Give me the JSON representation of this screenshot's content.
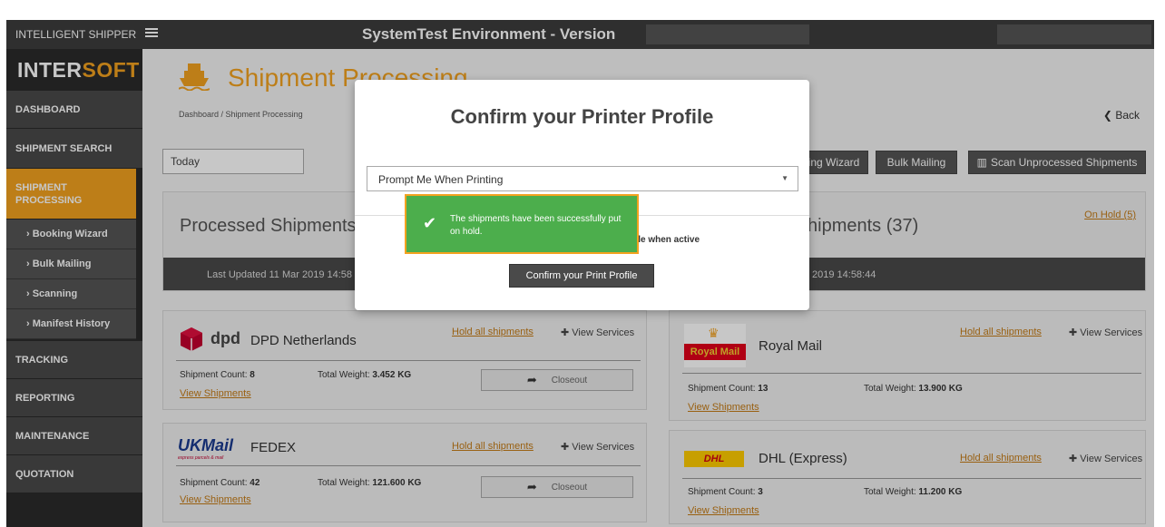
{
  "topbar": {
    "app_name": "INTELLIGENT SHIPPER",
    "environment_title": "SystemTest Environment - Version"
  },
  "sidebar": {
    "logo_a": "INTER",
    "logo_b": "SOFT",
    "items": [
      {
        "label": "DASHBOARD"
      },
      {
        "label": "SHIPMENT SEARCH"
      },
      {
        "label": "SHIPMENT PROCESSING"
      },
      {
        "label": "› Booking Wizard"
      },
      {
        "label": "› Bulk Mailing"
      },
      {
        "label": "› Scanning"
      },
      {
        "label": "› Manifest History"
      },
      {
        "label": "TRACKING"
      },
      {
        "label": "REPORTING"
      },
      {
        "label": "MAINTENANCE"
      },
      {
        "label": "QUOTATION"
      }
    ]
  },
  "main": {
    "page_title": "Shipment Processing",
    "breadcrumb": "Dashboard  /  Shipment Processing",
    "back_label": "Back",
    "date_filter": "Today",
    "buttons": {
      "booking_wizard": "ing Wizard",
      "bulk_mailing": "Bulk Mailing",
      "scan_unprocessed": "Scan Unprocessed Shipments"
    },
    "processed": {
      "title": "Processed Shipments",
      "last_updated": "Last Updated 11 Mar 2019 14:58"
    },
    "unprocessed": {
      "title": "hipments (37)",
      "on_hold": "On Hold (5)",
      "last_updated": "2019 14:58:44"
    },
    "carriers": [
      {
        "name": "DPD Netherlands",
        "logo": "dpd",
        "count_label": "Shipment Count:",
        "count": "8",
        "weight_label": "Total Weight:",
        "weight": "3.452 KG",
        "hold": "Hold all shipments",
        "services": "View Services",
        "view": "View Shipments",
        "closeout": "Closeout"
      },
      {
        "name": "FEDEX",
        "logo": "UKMail",
        "logo_sub": "express parcels & mail",
        "count_label": "Shipment Count:",
        "count": "42",
        "weight_label": "Total Weight:",
        "weight": "121.600 KG",
        "hold": "Hold all shipments",
        "services": "View Services",
        "view": "View Shipments",
        "closeout": "Closeout"
      },
      {
        "name": "Royal Mail",
        "logo": "Royal Mail",
        "count_label": "Shipment Count:",
        "count": "13",
        "weight_label": "Total Weight:",
        "weight": "13.900 KG",
        "hold": "Hold all shipments",
        "services": "View Services",
        "view": "View Shipments"
      },
      {
        "name": "DHL (Express)",
        "logo": "DHL",
        "count_label": "Shipment Count:",
        "count": "3",
        "weight_label": "Total Weight:",
        "weight": "11.200 KG",
        "hold": "Hold all shipments",
        "services": "View Services",
        "view": "View Shipments"
      }
    ]
  },
  "modal": {
    "title": "Confirm your Printer Profile",
    "select_value": "Prompt Me When Printing",
    "note": "ofile when active",
    "confirm_button": "Confirm your Print Profile"
  },
  "toast": {
    "message": "The shipments have been successfully put on hold."
  },
  "colors": {
    "accent": "#f3a21f",
    "sidebar": "#4a4a4a",
    "success": "#4cae4c",
    "link": "#c47b16"
  }
}
